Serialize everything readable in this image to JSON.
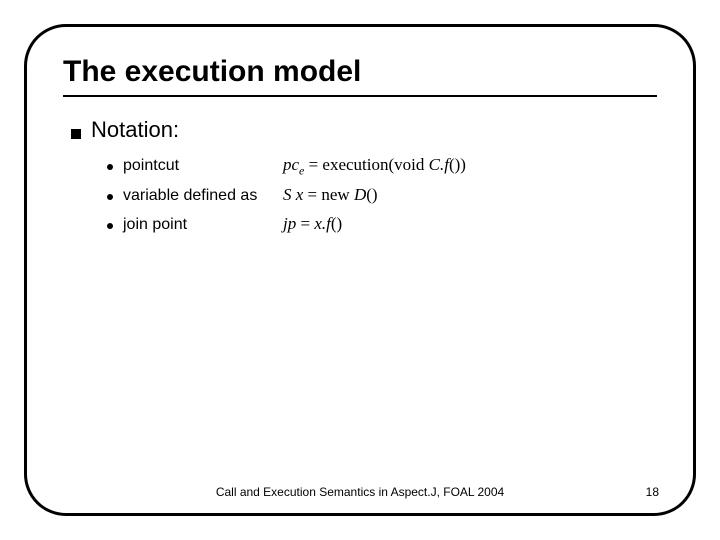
{
  "title": "The execution model",
  "section_label": "Notation:",
  "items": [
    {
      "label": "pointcut",
      "math_html": "<span>pc</span><sub>e</sub> <span class='rm'>= execution(void</span> C.f<span class='rm'>())</span>"
    },
    {
      "label": "variable defined as",
      "math_html": "S x <span class='rm'>= new</span> D<span class='rm'>()</span>"
    },
    {
      "label": "join point",
      "math_html": "jp <span class='rm'>=</span> x.f<span class='rm'>()</span>"
    }
  ],
  "footer": "Call and Execution Semantics in Aspect.J, FOAL 2004",
  "page_number": "18"
}
